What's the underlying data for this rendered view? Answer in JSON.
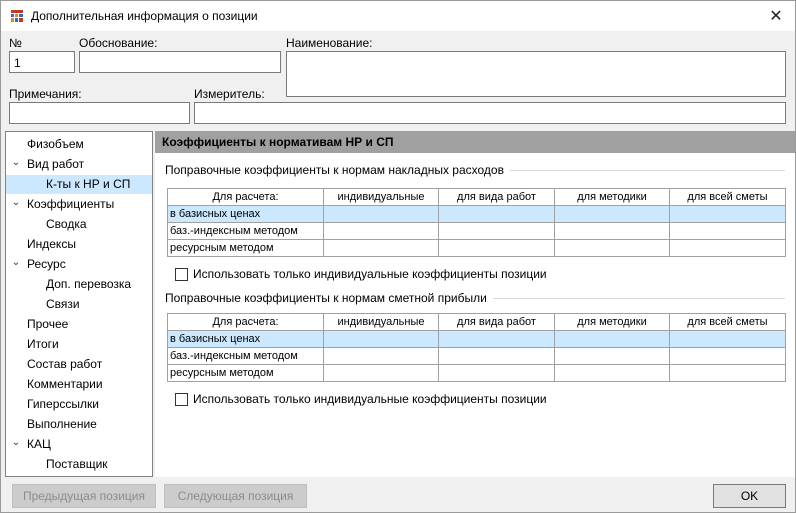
{
  "window": {
    "title": "Дополнительная информация о позиции",
    "close_symbol": "✕"
  },
  "form": {
    "number_label": "№",
    "number_value": "1",
    "basis_label": "Обоснование:",
    "basis_value": "",
    "name_label": "Наименование:",
    "name_value": "",
    "notes_label": "Примечания:",
    "notes_value": "",
    "unit_label": "Измеритель:",
    "unit_value": ""
  },
  "nav": {
    "items": [
      {
        "label": "Физобъем",
        "level": 1,
        "expander": ""
      },
      {
        "label": "Вид работ",
        "level": 1,
        "expander": "⌄"
      },
      {
        "label": "К-ты к НР и СП",
        "level": 2,
        "expander": "",
        "selected": true
      },
      {
        "label": "Коэффициенты",
        "level": 1,
        "expander": "⌄"
      },
      {
        "label": "Сводка",
        "level": 2,
        "expander": ""
      },
      {
        "label": "Индексы",
        "level": 1,
        "expander": ""
      },
      {
        "label": "Ресурс",
        "level": 1,
        "expander": "⌄"
      },
      {
        "label": "Доп. перевозка",
        "level": 2,
        "expander": ""
      },
      {
        "label": "Связи",
        "level": 2,
        "expander": ""
      },
      {
        "label": "Прочее",
        "level": 1,
        "expander": ""
      },
      {
        "label": "Итоги",
        "level": 1,
        "expander": ""
      },
      {
        "label": "Состав работ",
        "level": 1,
        "expander": ""
      },
      {
        "label": "Комментарии",
        "level": 1,
        "expander": ""
      },
      {
        "label": "Гиперссылки",
        "level": 1,
        "expander": ""
      },
      {
        "label": "Выполнение",
        "level": 1,
        "expander": ""
      },
      {
        "label": "КАЦ",
        "level": 1,
        "expander": "⌄"
      },
      {
        "label": "Поставщик",
        "level": 2,
        "expander": ""
      }
    ]
  },
  "panel": {
    "header": "Коэффициенты к нормативам НР и СП",
    "section1_title": "Поправочные коэффициенты к нормам накладных расходов",
    "section2_title": "Поправочные коэффициенты к нормам сметной прибыли",
    "columns": [
      "Для расчета:",
      "индивидуальные",
      "для вида работ",
      "для методики",
      "для всей сметы"
    ],
    "rows": [
      "в базисных ценах",
      "баз.-индексным методом",
      "ресурсным методом"
    ],
    "checkbox1_label": "Использовать только индивидуальные коэффициенты позиции",
    "checkbox2_label": "Использовать только индивидуальные коэффициенты позиции"
  },
  "buttons": {
    "prev": "Предыдущая позиция",
    "next": "Следующая позиция",
    "ok": "OK"
  },
  "colors": {
    "selection": "#cce8ff",
    "panel_header": "#a0a0a0"
  }
}
